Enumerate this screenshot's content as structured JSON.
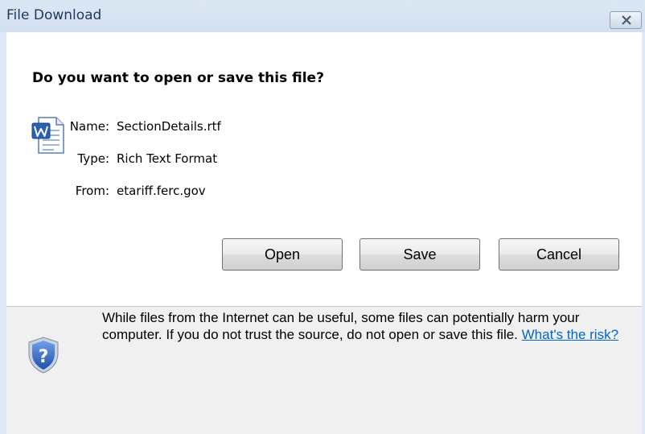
{
  "window": {
    "title": "File Download",
    "close_icon": "close-icon"
  },
  "prompt": {
    "heading": "Do you want to open or save this file?"
  },
  "file": {
    "icon": "word-document-icon",
    "name_label": "Name:",
    "name_value": "SectionDetails.rtf",
    "type_label": "Type:",
    "type_value": "Rich Text Format",
    "from_label": "From:",
    "from_value": "etariff.ferc.gov"
  },
  "buttons": {
    "open": "Open",
    "save": "Save",
    "cancel": "Cancel"
  },
  "warning": {
    "icon": "shield-question-icon",
    "text": "While files from the Internet can be useful, some files can potentially harm your computer. If you do not trust the source, do not open or save this file.",
    "link": "What's the risk?"
  }
}
